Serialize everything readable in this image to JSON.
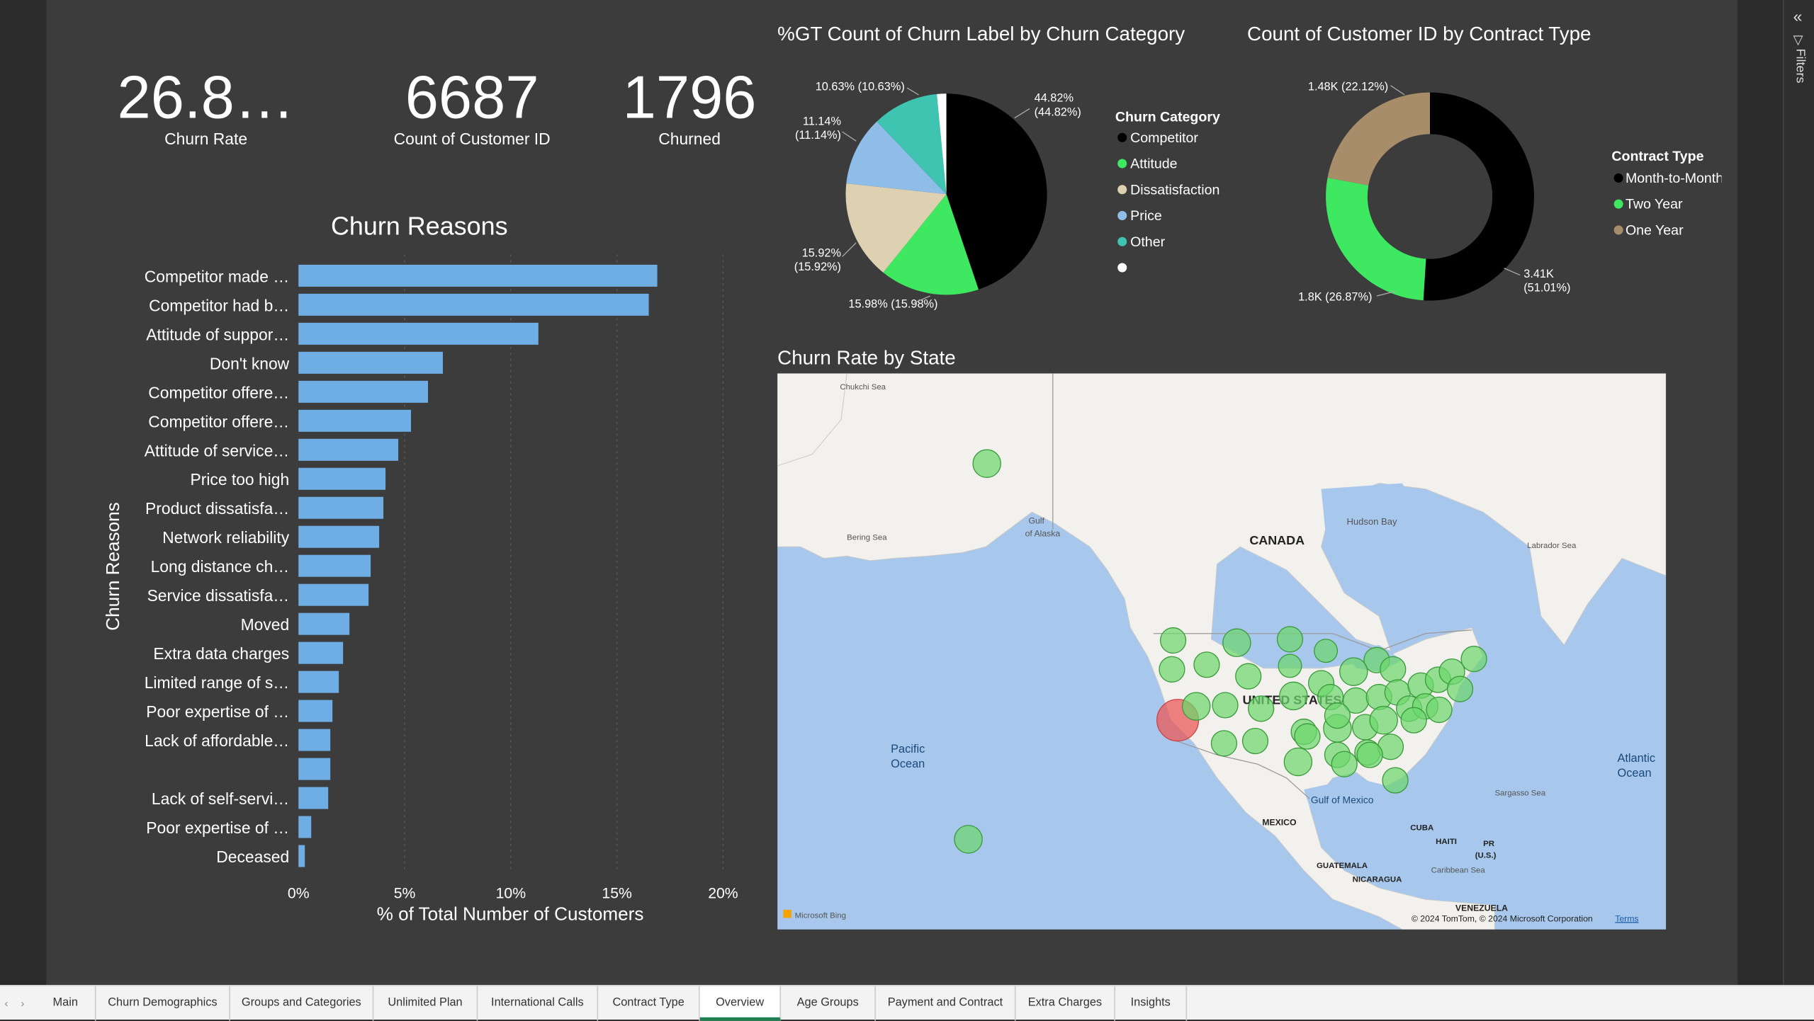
{
  "cards": [
    {
      "value": "26.8…",
      "label": "Churn Rate"
    },
    {
      "value": "6687",
      "label": "Count of Customer ID"
    },
    {
      "value": "1796",
      "label": "Churned"
    }
  ],
  "pie_title": "%GT Count of Churn Label by Churn Category",
  "donut_title": "Count of Customer ID by Contract Type",
  "bar_title": "Churn Reasons",
  "map_title": "Churn Rate by State",
  "filters_label": "Filters",
  "colors": {
    "competitor": "#000000",
    "attitude": "#3ee860",
    "dissatisfaction": "#ddd1b2",
    "price": "#8ebde8",
    "other": "#3ec4b0",
    "blank": "#ffffff",
    "bar": "#6faee4",
    "monthly": "#000000",
    "twoyear": "#3ee860",
    "oneyear": "#a88d6a"
  },
  "chart_data": [
    {
      "type": "pie",
      "title": "%GT Count of Churn Label by Churn Category",
      "legend_title": "Churn Category",
      "slices": [
        {
          "name": "Competitor",
          "value": 44.82,
          "label": "44.82%",
          "label2": "(44.82%)"
        },
        {
          "name": "Attitude",
          "value": 15.98,
          "label": "15.98% (15.98%)"
        },
        {
          "name": "Dissatisfaction",
          "value": 15.92,
          "label": "15.92%",
          "label2": "(15.92%)"
        },
        {
          "name": "Price",
          "value": 11.14,
          "label": "11.14%",
          "label2": "(11.14%)"
        },
        {
          "name": "Other",
          "value": 10.63,
          "label": "10.63% (10.63%)"
        },
        {
          "name": "",
          "value": 1.51
        }
      ]
    },
    {
      "type": "pie",
      "title": "Count of Customer ID by Contract Type",
      "legend_title": "Contract Type",
      "slices": [
        {
          "name": "Month-to-Month",
          "value": 51.01,
          "label": "3.41K",
          "label2": "(51.01%)"
        },
        {
          "name": "Two Year",
          "value": 26.87,
          "label": "1.8K (26.87%)"
        },
        {
          "name": "One Year",
          "value": 22.12,
          "label": "1.48K (22.12%)"
        }
      ]
    },
    {
      "type": "bar",
      "title": "Churn Reasons",
      "ylabel": "Churn Reasons",
      "xlabel": "% of Total Number of Customers",
      "xlim": [
        0,
        20
      ],
      "xticks": [
        "0%",
        "5%",
        "10%",
        "15%",
        "20%"
      ],
      "categories": [
        "Competitor made …",
        "Competitor had b…",
        "Attitude of suppor…",
        "Don't know",
        "Competitor offere…",
        "Competitor offere…",
        "Attitude of service…",
        "Price too high",
        "Product dissatisfa…",
        "Network reliability",
        "Long distance ch…",
        "Service dissatisfa…",
        "Moved",
        "Extra data charges",
        "Limited range of s…",
        "Poor expertise of …",
        "Lack of affordable…",
        "",
        "Lack of self-servi…",
        "Poor expertise of …",
        "Deceased"
      ],
      "values": [
        16.9,
        16.5,
        11.3,
        6.8,
        6.1,
        5.3,
        4.7,
        4.1,
        4.0,
        3.8,
        3.4,
        3.3,
        2.4,
        2.1,
        1.9,
        1.6,
        1.5,
        1.5,
        1.4,
        0.6,
        0.3
      ]
    }
  ],
  "map": {
    "labels": [
      "Chukchi Sea",
      "Bering Sea",
      "Gulf",
      "of Alaska",
      "CANADA",
      "Hudson Bay",
      "Labrador Sea",
      "UNITED STATES",
      "Pacific",
      "Ocean",
      "Atlantic",
      "Ocean",
      "Sargasso Sea",
      "Gulf of Mexico",
      "MEXICO",
      "CUBA",
      "HAITI",
      "PR",
      "(U.S.)",
      "GUATEMALA",
      "NICARAGUA",
      "Caribbean Sea",
      "VENEZUELA"
    ],
    "attribution": "© 2024 TomTom, © 2024 Microsoft Corporation",
    "terms": "Terms",
    "bing": "Microsoft Bing"
  },
  "tabs": [
    "Main",
    "Churn Demographics",
    "Groups and Categories",
    "Unlimited Plan",
    "International Calls",
    "Contract Type",
    "Overview",
    "Age Groups",
    "Payment and Contract",
    "Extra Charges",
    "Insights"
  ],
  "active_tab": "Overview"
}
